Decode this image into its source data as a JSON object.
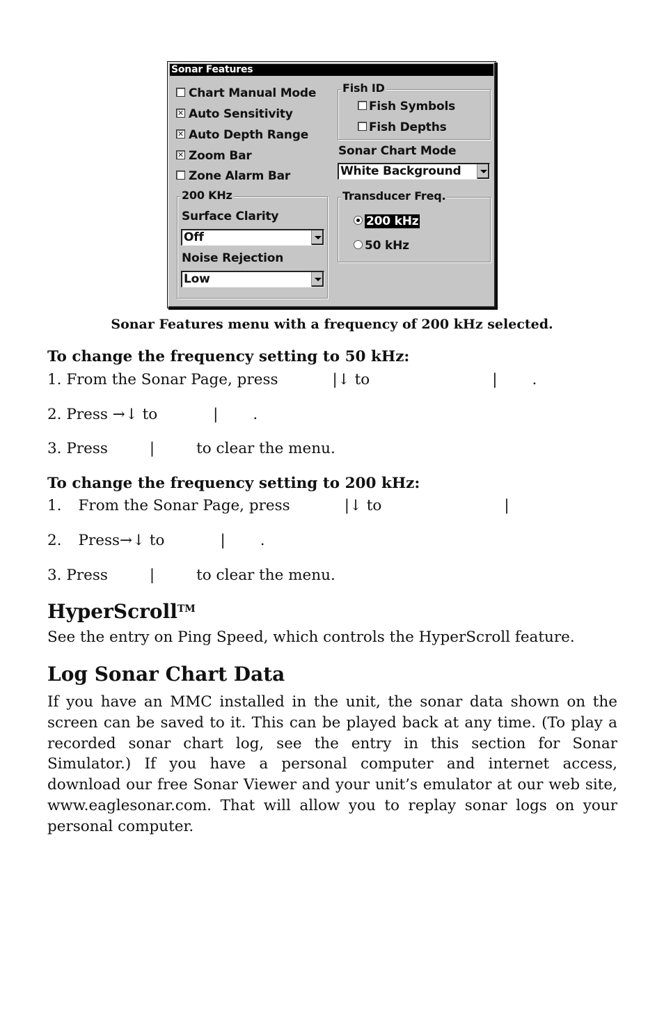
{
  "dialog": {
    "title": "Sonar Features",
    "checkboxes": [
      {
        "label": "Chart Manual Mode",
        "checked": false
      },
      {
        "label": "Auto Sensitivity",
        "checked": true
      },
      {
        "label": "Auto Depth Range",
        "checked": true
      },
      {
        "label": "Zoom Bar",
        "checked": true
      },
      {
        "label": "Zone Alarm Bar",
        "checked": false
      }
    ],
    "khz_group": {
      "label": "200 KHz",
      "surface_clarity_label": "Surface Clarity",
      "surface_clarity_value": "Off",
      "noise_rejection_label": "Noise Rejection",
      "noise_rejection_value": "Low"
    },
    "fish_id": {
      "label": "Fish ID",
      "items": [
        {
          "label": "Fish Symbols",
          "checked": false
        },
        {
          "label": "Fish Depths",
          "checked": false
        }
      ]
    },
    "sonar_chart_mode": {
      "label": "Sonar Chart Mode",
      "value": "White Background"
    },
    "transducer": {
      "label": "Transducer Freq.",
      "options": [
        {
          "label": "200 kHz",
          "selected": true
        },
        {
          "label": "50 kHz",
          "selected": false
        }
      ]
    },
    "check_mark": "☒"
  },
  "caption": "Sonar Features menu with a frequency of 200 kHz selected.",
  "section_50": {
    "heading": "To change the frequency setting to 50 kHz:",
    "step1_a": "1. From the Sonar Page, press",
    "step1_b": "|↓ to",
    "step1_c": "|",
    "step1_d": ".",
    "step2_a": "2. Press →↓ to",
    "step2_b": "|",
    "step2_c": ".",
    "step3_a": "3. Press",
    "step3_b": "|",
    "step3_c": "to clear the menu."
  },
  "section_200": {
    "heading": "To change the frequency setting to 200 kHz:",
    "step1_num": "1.",
    "step1_a": "From the Sonar Page, press",
    "step1_b": "|↓ to",
    "step1_c": "|",
    "step2_num": "2.",
    "step2_a": "Press→↓ to",
    "step2_b": "|",
    "step2_c": ".",
    "step3_a": "3. Press",
    "step3_b": "|",
    "step3_c": "to clear the menu."
  },
  "hyperscroll": {
    "heading": "HyperScroll",
    "tm": "TM",
    "body": "See the entry on Ping Speed, which controls the HyperScroll feature."
  },
  "log_sonar": {
    "heading": "Log Sonar Chart Data",
    "body": "If you have an MMC installed in the unit, the sonar data shown on the screen can be saved to it. This can be played back at any time. (To play a recorded sonar chart log, see the entry in this section for Sonar Simulator.) If you have a personal computer and internet access, download our free Sonar Viewer and your unit’s emulator at our web site, www.eaglesonar.com. That will allow you to replay sonar logs on your personal computer."
  }
}
